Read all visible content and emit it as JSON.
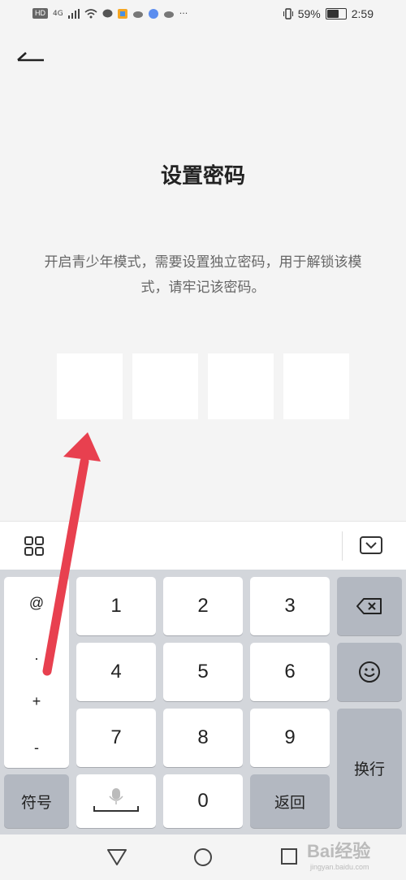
{
  "status_bar": {
    "network_badge": "HD",
    "signal_label": "4G",
    "battery_percent": "59%",
    "time": "2:59",
    "icons": [
      "wifi-icon",
      "chat-icon",
      "app-icon",
      "cloud-icon",
      "music-icon",
      "cloud-icon",
      "more-icon",
      "vibrate-icon",
      "battery-icon"
    ]
  },
  "page": {
    "title": "设置密码",
    "description": "开启青少年模式，需要设置独立密码，用于解锁该模式，请牢记该密码。",
    "pin_length": 4
  },
  "keyboard": {
    "symbols": [
      "@",
      ".",
      "+",
      "-"
    ],
    "digits": [
      "1",
      "2",
      "3",
      "4",
      "5",
      "6",
      "7",
      "8",
      "9",
      "0"
    ],
    "symbol_key": "符号",
    "return_key": "返回",
    "enter_key": "换行"
  },
  "watermark": {
    "text": "Bai经验",
    "sub": "jingyan.baidu.com"
  },
  "colors": {
    "arrow": "#e8404f",
    "background": "#f4f4f4",
    "keyboard_bg": "#d3d6db",
    "func_key": "#b3b8c1"
  }
}
